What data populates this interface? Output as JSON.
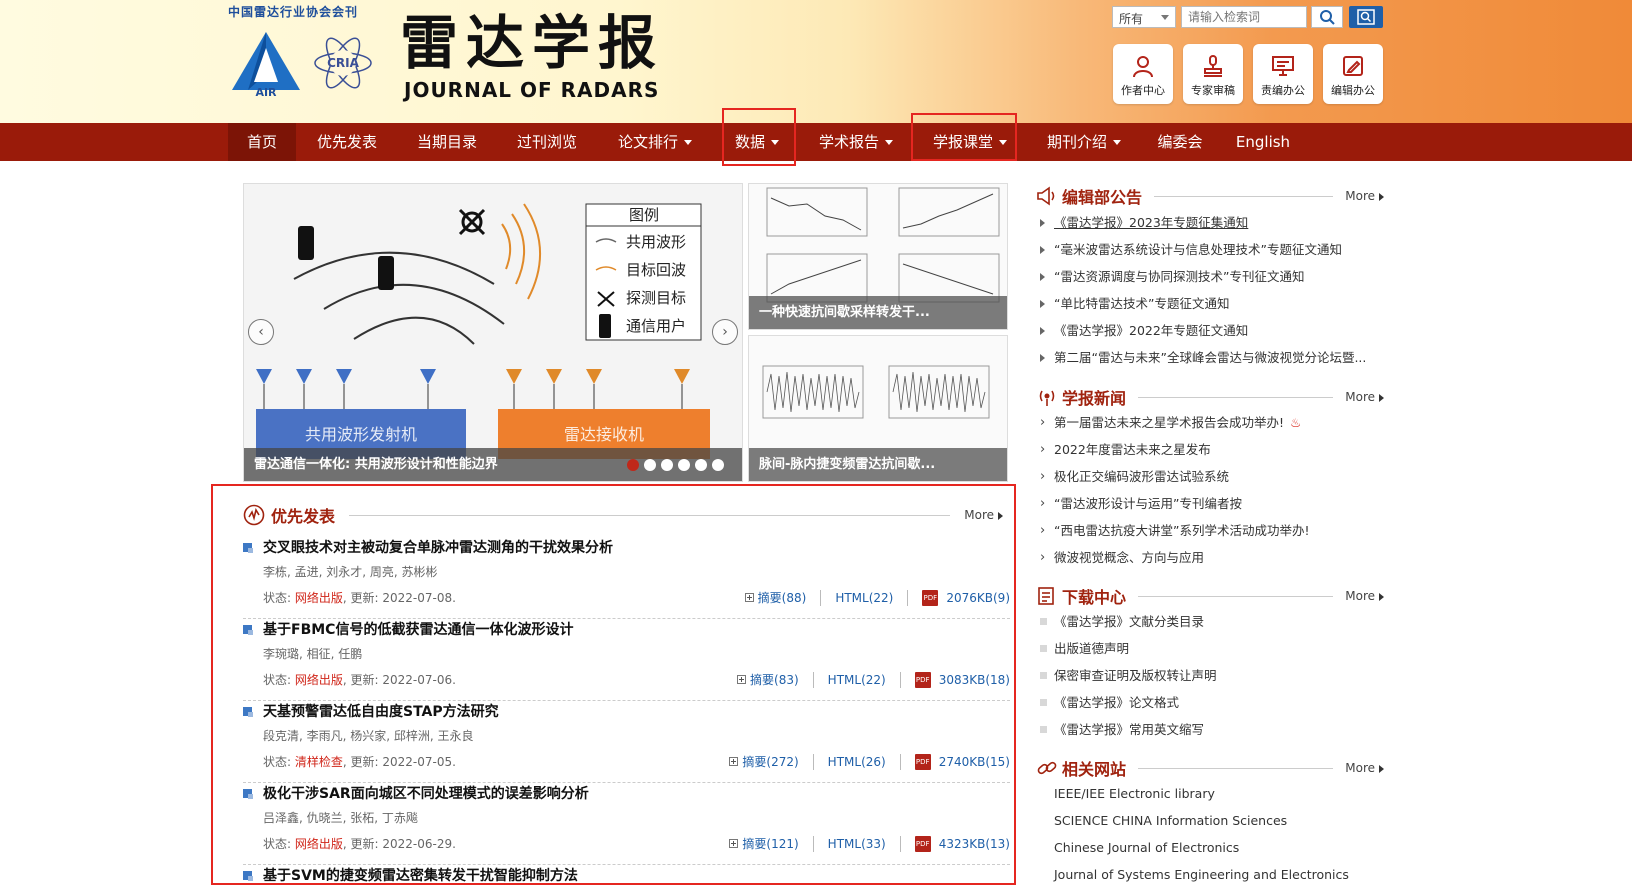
{
  "header": {
    "association": "中国雷达行业协会会刊",
    "logo_air_text": "AIR",
    "logo_cria_text": "CRIA",
    "title_cn": "雷达学报",
    "title_en": "JOURNAL OF RADARS"
  },
  "search": {
    "scope": "所有",
    "placeholder": "请输入检索词"
  },
  "quick_links": [
    {
      "label": "作者中心",
      "icon": "author-icon"
    },
    {
      "label": "专家审稿",
      "icon": "reviewer-icon"
    },
    {
      "label": "责编办公",
      "icon": "editor-icon"
    },
    {
      "label": "编辑办公",
      "icon": "office-icon"
    }
  ],
  "nav": [
    {
      "label": "首页",
      "dropdown": false
    },
    {
      "label": "优先发表",
      "dropdown": false
    },
    {
      "label": "当期目录",
      "dropdown": false
    },
    {
      "label": "过刊浏览",
      "dropdown": false
    },
    {
      "label": "论文排行",
      "dropdown": true
    },
    {
      "label": "数据",
      "dropdown": true
    },
    {
      "label": "学术报告",
      "dropdown": true
    },
    {
      "label": "学报课堂",
      "dropdown": true
    },
    {
      "label": "期刊介绍",
      "dropdown": true
    },
    {
      "label": "编委会",
      "dropdown": false
    },
    {
      "label": "English",
      "dropdown": false
    }
  ],
  "carousel": {
    "caption": "雷达通信一体化: 共用波形设计和性能边界",
    "legend_title": "图例",
    "legend_items": [
      "共用波形",
      "目标回波",
      "探测目标",
      "通信用户"
    ],
    "tx_label": "共用波形发射机",
    "rx_label": "雷达接收机",
    "slide_count": 6,
    "active_slide": 0
  },
  "thumbs": [
    {
      "caption": "一种快速抗间歇采样转发干..."
    },
    {
      "caption": "脉间-脉内捷变频雷达抗间歇..."
    }
  ],
  "priority": {
    "title": "优先发表",
    "more": "More",
    "status_label": "状态: ",
    "update_label": "更新: ",
    "abstract_label": "摘要",
    "html_label": "HTML",
    "articles": [
      {
        "title": "交叉眼技术对主被动复合单脉冲雷达测角的干扰效果分析",
        "authors": "李栋, 孟进, 刘永才, 周亮, 苏彬彬",
        "status": "网络出版",
        "date": "2022-07-08.",
        "abstract_count": "(88)",
        "html_count": "(22)",
        "pdf": "2076KB",
        "pdf_count": "(9)"
      },
      {
        "title": "基于FBMC信号的低截获雷达通信一体化波形设计",
        "authors": "李琬璐, 相征, 任鹏",
        "status": "网络出版",
        "date": "2022-07-06.",
        "abstract_count": "(83)",
        "html_count": "(22)",
        "pdf": "3083KB",
        "pdf_count": "(18)"
      },
      {
        "title": "天基预警雷达低自由度STAP方法研究",
        "authors": "段克清, 李雨凡, 杨兴家, 邱梓洲, 王永良",
        "status": "清样检查",
        "date": "2022-07-05.",
        "abstract_count": "(272)",
        "html_count": "(26)",
        "pdf": "2740KB",
        "pdf_count": "(15)"
      },
      {
        "title": "极化干涉SAR面向城区不同处理模式的误差影响分析",
        "authors": "吕泽鑫, 仇晓兰, 张柘, 丁赤飚",
        "status": "网络出版",
        "date": "2022-06-29.",
        "abstract_count": "(121)",
        "html_count": "(33)",
        "pdf": "4323KB",
        "pdf_count": "(13)"
      },
      {
        "title": "基于SVM的捷变频雷达密集转发干扰智能抑制方法",
        "authors": "",
        "status": "",
        "date": "",
        "abstract_count": "",
        "html_count": "",
        "pdf": "",
        "pdf_count": ""
      }
    ]
  },
  "sidebar": {
    "notices": {
      "title": "编辑部公告",
      "more": "More",
      "items": [
        "《雷达学报》2023年专题征集通知",
        "“毫米波雷达系统设计与信息处理技术”专题征文通知",
        "“雷达资源调度与协同探测技术”专刊征文通知",
        "“单比特雷达技术”专题征文通知",
        "《雷达学报》2022年专题征文通知",
        "第二届“雷达与未来”全球峰会雷达与微波视觉分论坛暨..."
      ]
    },
    "news": {
      "title": "学报新闻",
      "more": "More",
      "items": [
        "第一届雷达未来之星学术报告会成功举办!",
        "2022年度雷达未来之星发布",
        "极化正交编码波形雷达试验系统",
        "“雷达波形设计与运用”专刊编者按",
        "“西电雷达抗疫大讲堂”系列学术活动成功举办!",
        "微波视觉概念、方向与应用"
      ]
    },
    "downloads": {
      "title": "下载中心",
      "more": "More",
      "items": [
        "《雷达学报》文献分类目录",
        "出版道德声明",
        "保密审查证明及版权转让声明",
        "《雷达学报》论文格式",
        "《雷达学报》常用英文缩写"
      ]
    },
    "links": {
      "title": "相关网站",
      "more": "More",
      "items": [
        "IEEE/IEE Electronic library",
        "SCIENCE CHINA Information Sciences",
        "Chinese Journal of Electronics",
        "Journal of Systems Engineering and Electronics"
      ]
    }
  },
  "colors": {
    "nav_bg": "#9a1b0a",
    "accent_red": "#a0230f",
    "highlight_box": "#e52620",
    "link_blue": "#1f5fa8"
  }
}
